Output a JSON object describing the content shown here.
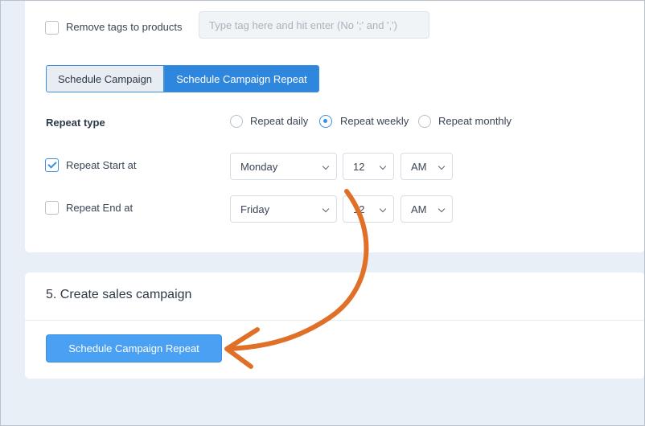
{
  "tags": {
    "remove_label": "Remove tags to products",
    "input_placeholder": "Type tag here and hit enter (No ';' and ',')",
    "remove_checked": false
  },
  "schedule_tabs": [
    {
      "label": "Schedule Campaign",
      "active": false
    },
    {
      "label": "Schedule Campaign Repeat",
      "active": true
    }
  ],
  "repeat_type": {
    "label": "Repeat type",
    "options": [
      {
        "label": "Repeat daily",
        "selected": false
      },
      {
        "label": "Repeat weekly",
        "selected": true
      },
      {
        "label": "Repeat monthly",
        "selected": false
      }
    ]
  },
  "repeat_start": {
    "label": "Repeat Start at",
    "checked": true,
    "day": "Monday",
    "hour": "12",
    "period": "AM"
  },
  "repeat_end": {
    "label": "Repeat End at",
    "checked": false,
    "day": "Friday",
    "hour": "12",
    "period": "AM"
  },
  "create_section": {
    "title": "5. Create sales campaign",
    "button_label": "Schedule Campaign Repeat"
  },
  "colors": {
    "accent": "#2f86dd",
    "button": "#4aa0f2",
    "annotation_arrow": "#e07028",
    "page_bg": "#e9eff6"
  },
  "icons": [
    "check-icon",
    "chevron-down-icon",
    "curved-arrow-annotation"
  ]
}
